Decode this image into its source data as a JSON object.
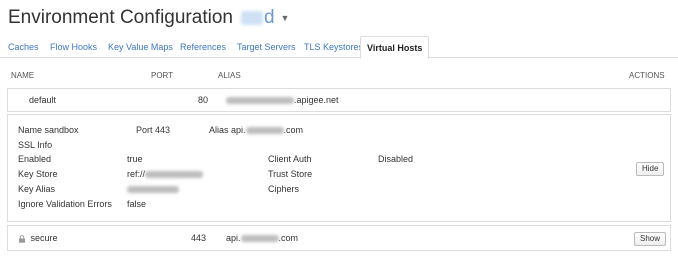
{
  "header": {
    "title": "Environment Configuration",
    "env_suffix": "d"
  },
  "tabs": [
    {
      "label": "Caches"
    },
    {
      "label": "Flow Hooks"
    },
    {
      "label": "Key Value Maps"
    },
    {
      "label": "References"
    },
    {
      "label": "Target Servers"
    },
    {
      "label": "TLS Keystores"
    },
    {
      "label": "Virtual Hosts",
      "active": true
    }
  ],
  "columns": {
    "name": "NAME",
    "port": "PORT",
    "alias": "ALIAS",
    "actions": "ACTIONS"
  },
  "hosts": {
    "default": {
      "name": "default",
      "port": "80",
      "alias_suffix": ".apigee.net"
    },
    "sandbox": {
      "name_label": "Name",
      "name": "sandbox",
      "port_label": "Port",
      "port": "443",
      "alias_label": "Alias",
      "alias_prefix": "api.",
      "alias_suffix": ".com",
      "ssl_info_label": "SSL Info",
      "enabled_label": "Enabled",
      "enabled_value": "true",
      "client_auth_label": "Client Auth",
      "client_auth_value": "Disabled",
      "key_store_label": "Key Store",
      "key_store_prefix": "ref://",
      "trust_store_label": "Trust Store",
      "key_alias_label": "Key Alias",
      "ciphers_label": "Ciphers",
      "ignore_errors_label": "Ignore Validation Errors",
      "ignore_errors_value": "false",
      "hide_label": "Hide"
    },
    "secure": {
      "name": "secure",
      "port": "443",
      "alias_prefix": "api.",
      "alias_suffix": ".com",
      "show_label": "Show"
    }
  },
  "icons": {
    "caret": "caret-down-icon",
    "lock": "lock-icon"
  }
}
